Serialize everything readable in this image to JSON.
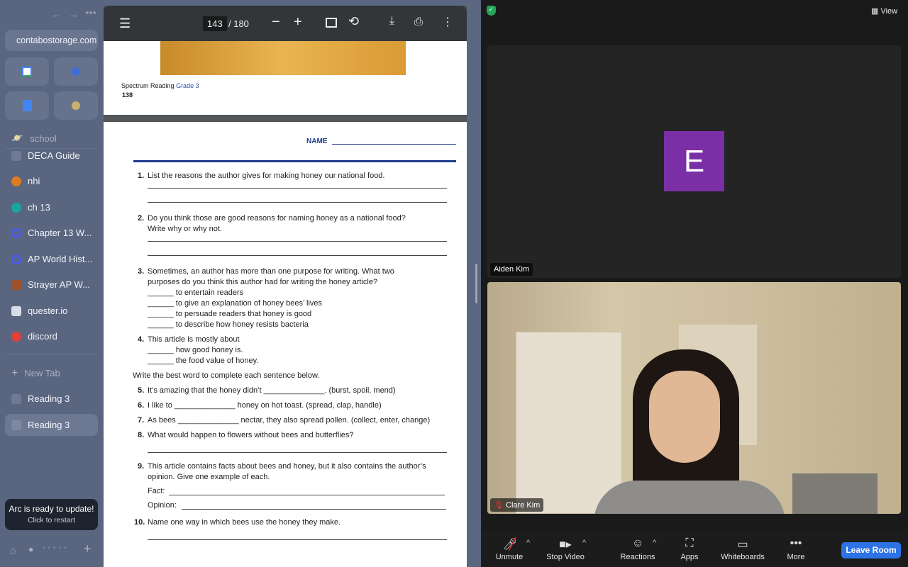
{
  "sidebar": {
    "url": "contabostorage.com",
    "section": "school",
    "items": [
      {
        "label": "DECA Guide",
        "color": "#6f7a95"
      },
      {
        "label": "nhi",
        "color": "#e07b1f"
      },
      {
        "label": "ch 13",
        "color": "#19a5a0"
      },
      {
        "label": "Chapter 13 W...",
        "color": "#4a5bf0"
      },
      {
        "label": "AP World Hist...",
        "color": "#4a5bf0"
      },
      {
        "label": "Strayer AP W...",
        "color": "#a0522d"
      },
      {
        "label": "quester.io",
        "color": "#d9dde8"
      },
      {
        "label": "discord",
        "color": "#e0403a"
      }
    ],
    "new_tab": "New Tab",
    "tabs": [
      {
        "label": "Reading 3"
      },
      {
        "label": "Reading 3"
      }
    ],
    "update_title": "Arc is ready to update!",
    "update_sub": "Click to restart"
  },
  "pdf": {
    "page_current": "143",
    "page_total": "/ 180",
    "footer_prefix": "Spectrum Reading",
    "footer_grade": "Grade 3",
    "footer_page": "138",
    "name_label": "NAME",
    "questions": [
      {
        "n": "1.",
        "lines": [
          "List the reasons the author gives for making honey our national food."
        ]
      },
      {
        "n": "2.",
        "lines": [
          "Do you think those are good reasons for naming honey as a national food?",
          "Write why or why not."
        ]
      },
      {
        "n": "3.",
        "lines": [
          "Sometimes, an author has more than one purpose for writing. What two",
          "purposes do you think this author had for writing the honey article?",
          "______ to entertain readers",
          "______ to give an explanation of honey bees’ lives",
          "______ to persuade readers that honey is good",
          "______ to describe how honey resists bacteria"
        ]
      },
      {
        "n": "4.",
        "lines": [
          "This article is mostly about",
          "______ how good honey is.",
          "______ the food value of honey."
        ]
      }
    ],
    "instruction": "Write the best word to complete each sentence below.",
    "questions2": [
      {
        "n": "5.",
        "text": "It’s amazing that the honey didn’t ______________. (burst, spoil, mend)"
      },
      {
        "n": "6.",
        "text": "I like to ______________ honey on hot toast. (spread, clap, handle)"
      },
      {
        "n": "7.",
        "text": "As bees ______________ nectar, they also spread pollen. (collect, enter, change)"
      },
      {
        "n": "8.",
        "text": "What would happen to flowers without bees and butterflies?"
      }
    ],
    "q9": {
      "n": "9.",
      "lines": [
        "This article contains facts about bees and honey, but it also contains the author’s",
        "opinion. Give one example of each."
      ],
      "fact": "Fact:",
      "opinion": "Opinion:"
    },
    "q10": {
      "n": "10.",
      "text": "Name one way in which bees use the honey they make."
    }
  },
  "zoom": {
    "view": "View",
    "p1": {
      "name": "Aiden Kim",
      "initial": "E",
      "color": "#7b2fa6"
    },
    "p2": {
      "name": "Clare Kim"
    },
    "toolbar": {
      "unmute": "Unmute",
      "stop_video": "Stop Video",
      "reactions": "Reactions",
      "apps": "Apps",
      "whiteboards": "Whiteboards",
      "more": "More",
      "leave": "Leave Room"
    }
  }
}
